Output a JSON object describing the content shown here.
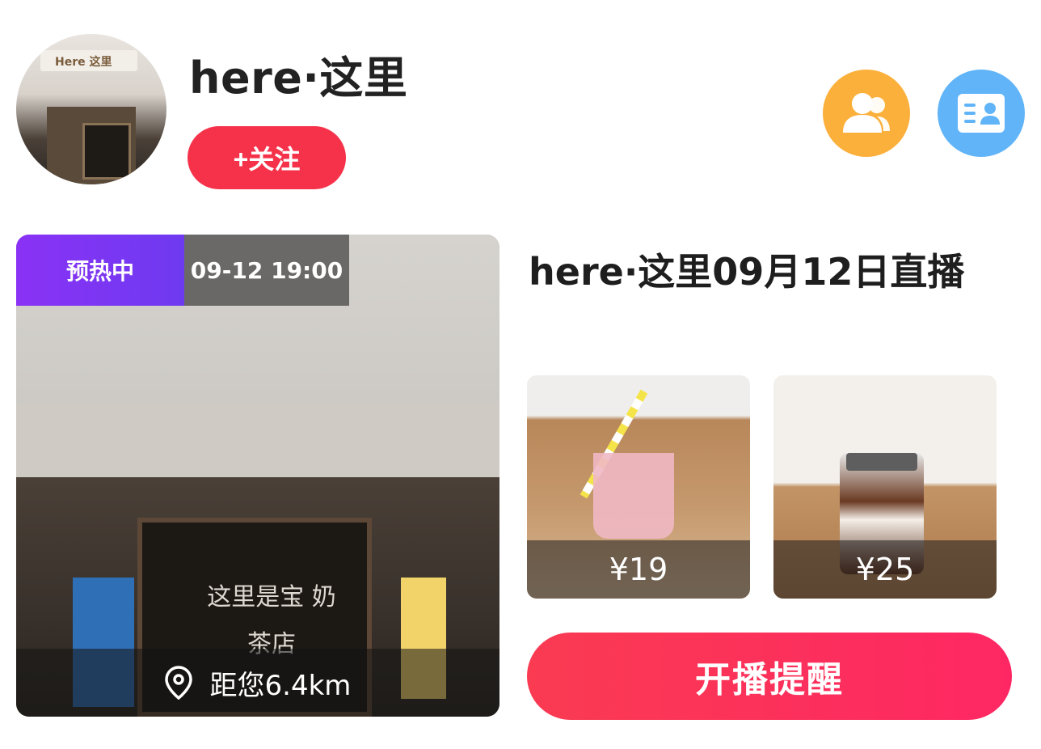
{
  "header": {
    "shop_name": "here·这里",
    "follow_label": "+关注",
    "avatar_sign_text": "Here 这里",
    "fans_icon": "users-icon",
    "card_icon": "contact-card-icon",
    "colors": {
      "follow": "#f6324a",
      "fans": "#fbb03b",
      "card": "#60b4f7"
    }
  },
  "live": {
    "badge_status": "预热中",
    "badge_time": "09-12 19:00",
    "distance": "距您6.4km",
    "location_icon": "location-pin-icon",
    "photo_window_text": "这里是宝 奶茶店",
    "title": "here·这里09月12日直播",
    "remind_label": "开播提醒",
    "colors": {
      "badge": "#8a32f5",
      "remind": "#fa3b52"
    }
  },
  "products": [
    {
      "price": "¥19"
    },
    {
      "price": "¥25"
    }
  ]
}
